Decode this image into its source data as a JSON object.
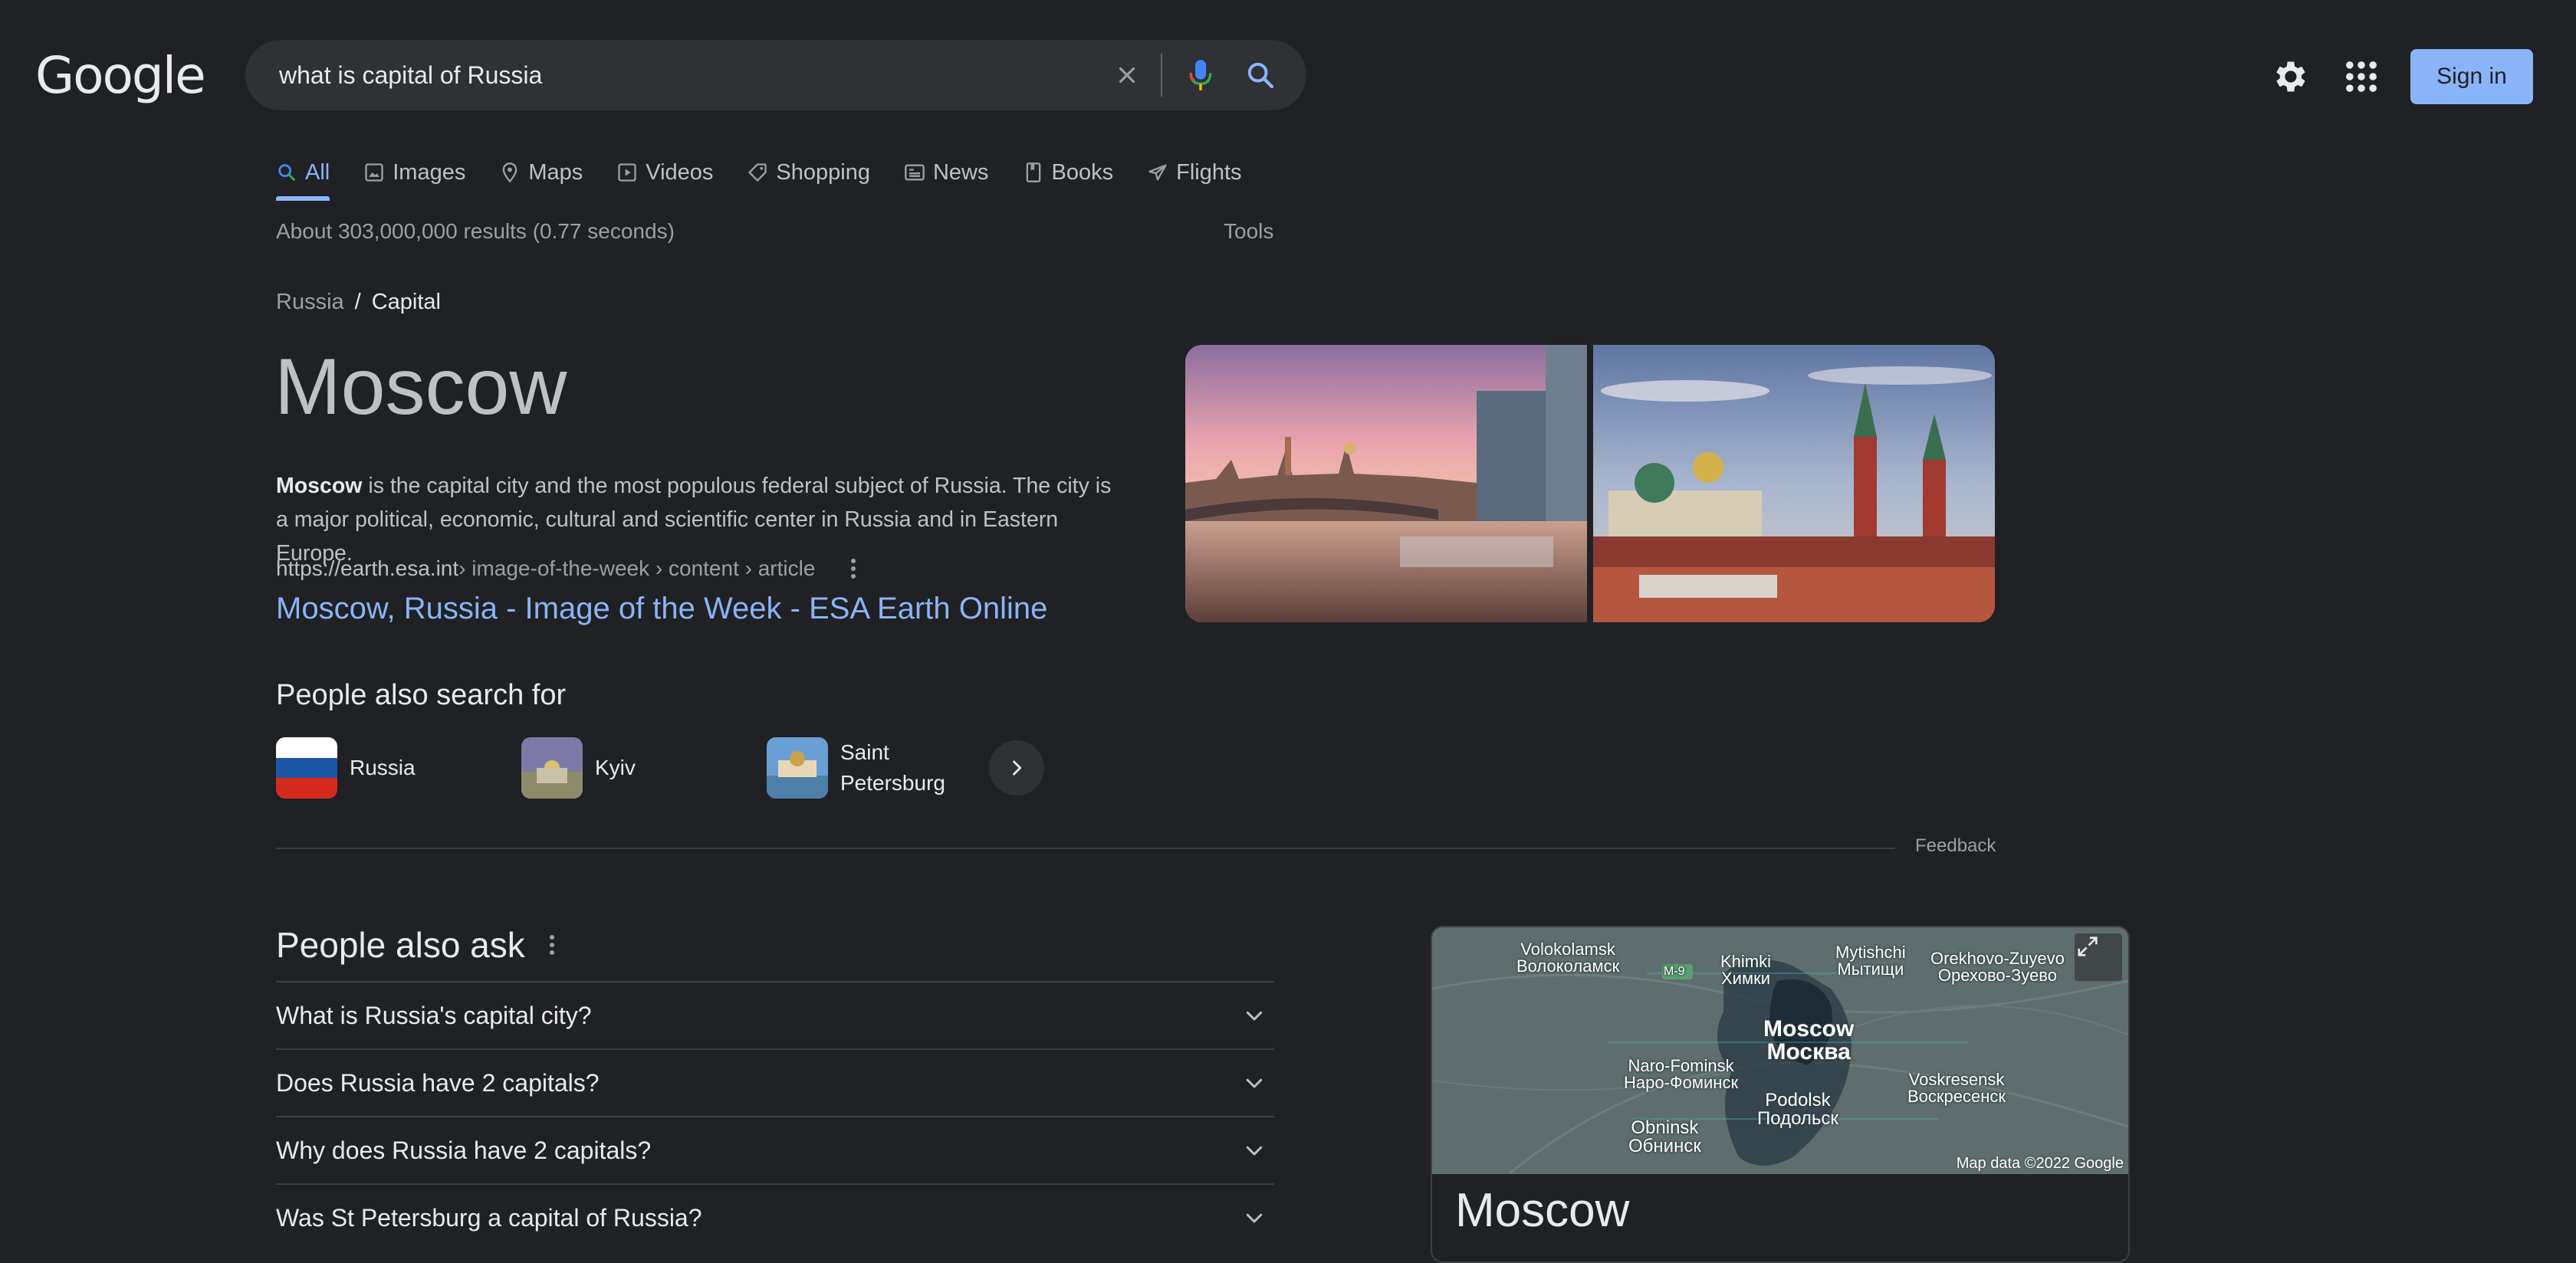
{
  "header": {
    "logo_text": "Google",
    "search": {
      "value": "what is capital of Russia",
      "placeholder": ""
    },
    "signin_label": "Sign in"
  },
  "tabs": [
    {
      "label": "All",
      "icon": "search-icon",
      "active": true
    },
    {
      "label": "Images",
      "icon": "image-icon",
      "active": false
    },
    {
      "label": "Maps",
      "icon": "map-pin-icon",
      "active": false
    },
    {
      "label": "Videos",
      "icon": "play-icon",
      "active": false
    },
    {
      "label": "Shopping",
      "icon": "tag-icon",
      "active": false
    },
    {
      "label": "News",
      "icon": "newspaper-icon",
      "active": false
    },
    {
      "label": "Books",
      "icon": "book-icon",
      "active": false
    },
    {
      "label": "Flights",
      "icon": "airplane-icon",
      "active": false
    }
  ],
  "results": {
    "count_text": "About 303,000,000 results (0.77 seconds)",
    "tools_label": "Tools"
  },
  "answer": {
    "breadcrumb": {
      "parent": "Russia",
      "separator": "/",
      "current": "Capital"
    },
    "title": "Moscow",
    "description_bold": "Moscow",
    "description_rest": " is the capital city and the most populous federal subject of Russia. The city is a major political, economic, cultural and scientific center in Russia and in Eastern Europe.",
    "source_domain": "https://earth.esa.int",
    "source_path": " › image-of-the-week › content › article",
    "source_link_title": "Moscow, Russia - Image of the Week - ESA Earth Online"
  },
  "people_also_search": {
    "heading": "People also search for",
    "items": [
      {
        "label": "Russia"
      },
      {
        "label": "Kyiv"
      },
      {
        "label": "Saint Petersburg"
      }
    ],
    "feedback_label": "Feedback"
  },
  "people_also_ask": {
    "heading": "People also ask",
    "questions": [
      "What is Russia's capital city?",
      "Does Russia have 2 capitals?",
      "Why does Russia have 2 capitals?",
      "Was St Petersburg a capital of Russia?"
    ]
  },
  "knowledge_panel": {
    "map_labels": {
      "volokolamsk_en": "Volokolamsk",
      "volokolamsk_ru": "Волоколамск",
      "m9": "M-9",
      "khimki_en": "Khimki",
      "khimki_ru": "Химки",
      "mytishchi_en": "Mytishchi",
      "mytishchi_ru": "Мытищи",
      "orekhovo_en": "Orekhovo-Zuyevo",
      "orekhovo_ru": "Орехово-Зуево",
      "moscow_en": "Moscow",
      "moscow_ru": "Москва",
      "naro_en": "Naro-Fominsk",
      "naro_ru": "Наро-Фоминск",
      "voskresensk_en": "Voskresensk",
      "voskresensk_ru": "Воскресенск",
      "podolsk_en": "Podolsk",
      "podolsk_ru": "Подольск",
      "obninsk_en": "Obninsk",
      "obninsk_ru": "Обнинск"
    },
    "map_attribution": "Map data ©2022 Google",
    "title": "Moscow"
  },
  "colors": {
    "background": "#202124",
    "accent": "#8ab4f8",
    "search_box": "#303134",
    "divider": "#3c4043"
  }
}
